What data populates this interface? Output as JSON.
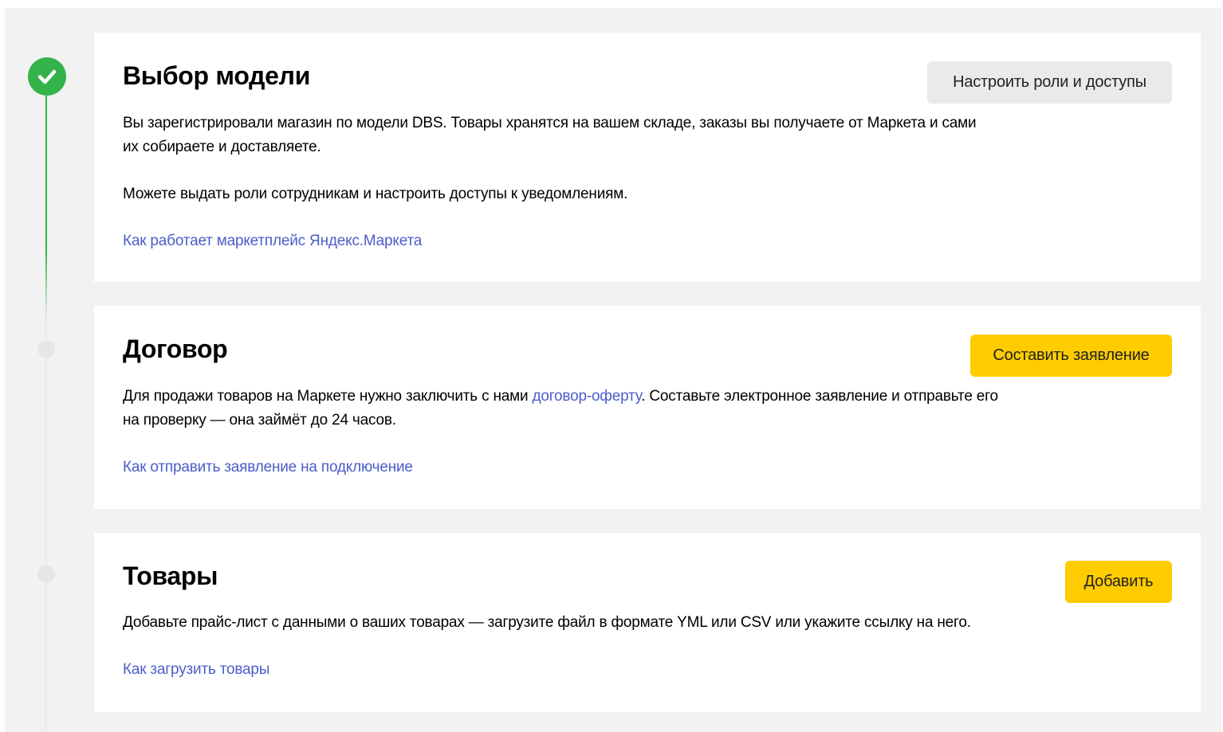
{
  "steps": [
    {
      "title": "Выбор модели",
      "status": "done",
      "button": "Настроить роли и доступы",
      "description_line1": "Вы зарегистрировали магазин по модели DBS. Товары хранятся на вашем складе, заказы вы получаете от Маркета и сами",
      "description_line2": "их собираете и доставляете.",
      "note": "Можете выдать роли сотрудникам и настроить доступы к уведомлениям.",
      "help_link": "Как работает маркетплейс Яндекс.Маркета"
    },
    {
      "title": "Договор",
      "status": "pending",
      "button": "Составить заявление",
      "description_before_link": "Для продажи товаров на Маркете нужно заключить с нами ",
      "description_link": "договор-оферту",
      "description_after_link": ". Составьте электронное заявление и отправьте его",
      "description_line2": "на проверку — она займёт до 24 часов.",
      "help_link": "Как отправить заявление на подключение"
    },
    {
      "title": "Товары",
      "status": "pending",
      "button": "Добавить",
      "description": "Добавьте прайс-лист с данными о ваших товарах — загрузите файл в формате YML или CSV или укажите ссылку на него.",
      "help_link": "Как загрузить товары"
    }
  ],
  "colors": {
    "done": "#33b34a",
    "primary_button": "#ffcc00",
    "secondary_button": "#eaeaea",
    "link": "#4b5ec9"
  },
  "icons": {
    "done_step": "checkmark-icon",
    "pending_step": "step-dot-icon"
  }
}
